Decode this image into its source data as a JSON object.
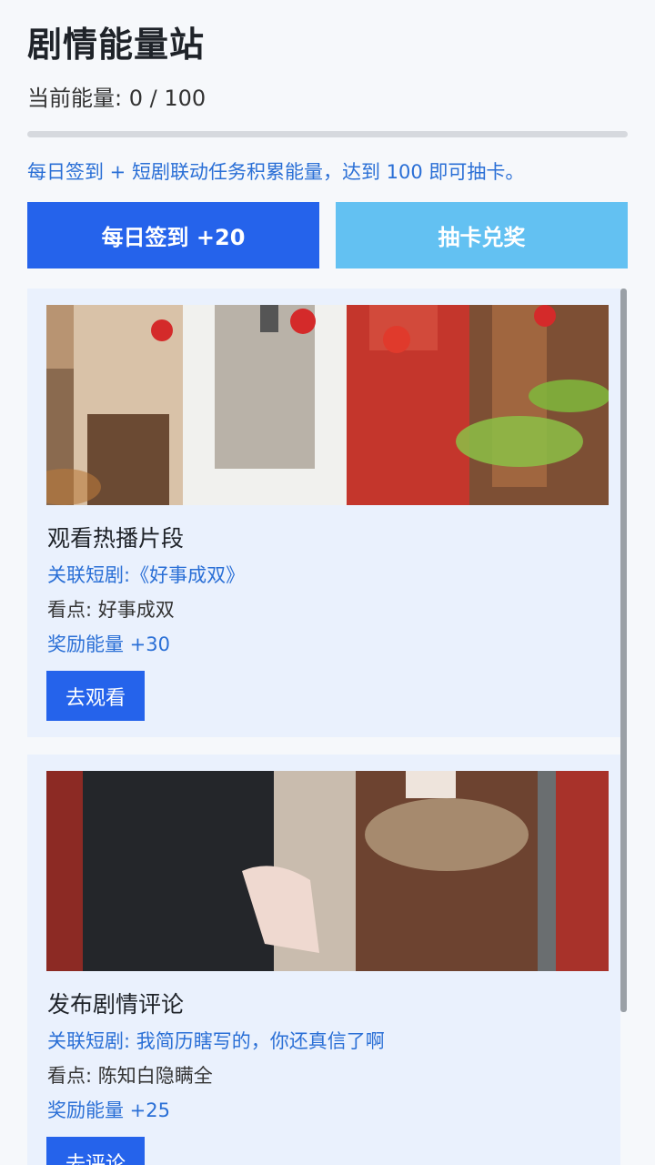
{
  "header": {
    "title": "剧情能量站",
    "energy_text": "当前能量: 0 / 100",
    "energy_progress": 0,
    "hint": "每日签到 + 短剧联动任务积累能量，达到 100 即可抽卡。"
  },
  "buttons": {
    "checkin_label": "每日签到 +20",
    "draw_label": "抽卡兑奖"
  },
  "colors": {
    "primary": "#2563eb",
    "secondary": "#63c1f2",
    "link": "#2a6fd6",
    "card_bg": "#eaf1fd"
  },
  "tasks": [
    {
      "name": "观看热播片段",
      "related": "关联短剧:《好事成双》",
      "highlight": "看点: 好事成双",
      "reward": "奖励能量 +30",
      "action": "去观看"
    },
    {
      "name": "发布剧情评论",
      "related": "关联短剧: 我简历瞎写的，你还真信了啊",
      "highlight": "看点: 陈知白隐瞒全",
      "reward": "奖励能量 +25",
      "action": "去评论"
    }
  ]
}
